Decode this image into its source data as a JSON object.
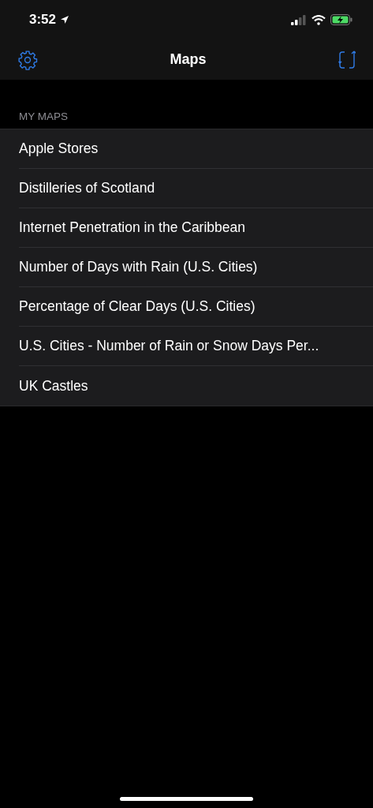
{
  "status_bar": {
    "time": "3:52"
  },
  "nav_bar": {
    "title": "Maps"
  },
  "section": {
    "header": "MY MAPS",
    "items": [
      {
        "label": "Apple Stores"
      },
      {
        "label": "Distilleries of Scotland"
      },
      {
        "label": "Internet Penetration in the Caribbean"
      },
      {
        "label": "Number of Days with Rain (U.S. Cities)"
      },
      {
        "label": "Percentage of Clear Days (U.S. Cities)"
      },
      {
        "label": "U.S. Cities - Number of Rain or Snow Days Per..."
      },
      {
        "label": "UK Castles"
      }
    ]
  }
}
